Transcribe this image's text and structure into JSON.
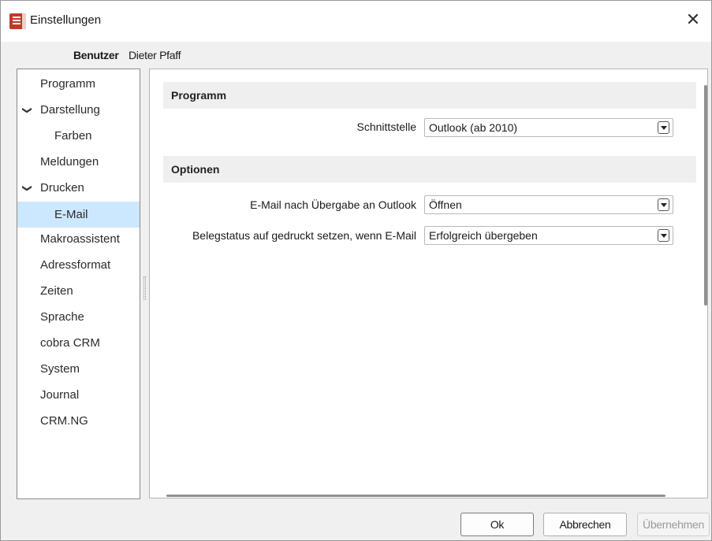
{
  "window": {
    "title": "Einstellungen",
    "close_glyph": "✕"
  },
  "user": {
    "label": "Benutzer",
    "name": "Dieter Pfaff"
  },
  "sidebar": {
    "items": [
      {
        "label": "Programm"
      },
      {
        "label": "Darstellung",
        "expanded": true
      },
      {
        "label": "Farben"
      },
      {
        "label": "Meldungen"
      },
      {
        "label": "Drucken",
        "expanded": true
      },
      {
        "label": "E-Mail",
        "selected": true
      },
      {
        "label": "Makroassistent"
      },
      {
        "label": "Adressformat"
      },
      {
        "label": "Zeiten"
      },
      {
        "label": "Sprache"
      },
      {
        "label": "cobra CRM"
      },
      {
        "label": "System"
      },
      {
        "label": "Journal"
      },
      {
        "label": "CRM.NG"
      }
    ],
    "chevron_glyph": "❯"
  },
  "sections": {
    "programm": {
      "title": "Programm",
      "fields": [
        {
          "label": "Schnittstelle",
          "value": "Outlook (ab 2010)"
        }
      ]
    },
    "optionen": {
      "title": "Optionen",
      "fields": [
        {
          "label": "E-Mail nach Übergabe an Outlook",
          "value": "Öffnen"
        },
        {
          "label": "Belegstatus auf gedruckt setzen, wenn E-Mail",
          "value": "Erfolgreich übergeben"
        }
      ]
    }
  },
  "buttons": {
    "ok": "Ok",
    "cancel": "Abbrechen",
    "apply": "Übernehmen"
  },
  "colors": {
    "selected_bg": "#cce8ff",
    "section_bg": "#efefef",
    "icon_red": "#c0392b"
  }
}
